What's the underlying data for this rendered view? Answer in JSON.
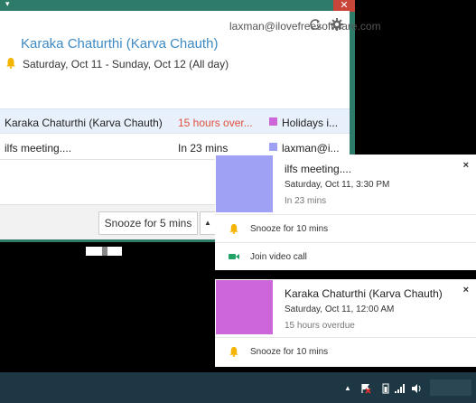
{
  "window": {
    "close_glyph": "✕",
    "caret_glyph": "▾",
    "accent": "#2d7b68"
  },
  "header": {
    "email": "laxman@ilovefreesoftware.com",
    "refresh_icon": "refresh-icon",
    "settings_icon": "gear-icon"
  },
  "event": {
    "title": "Karaka Chaturthi (Karva Chauth)",
    "date": "Saturday, Oct 11 - Sunday, Oct 12 (All day)",
    "title_color": "#3e8ac4"
  },
  "reminders": [
    {
      "title": "Karaka Chaturthi (Karva Chauth)",
      "time": "15 hours over...",
      "calendar": "Holidays i...",
      "color": "#cc66d9"
    },
    {
      "title": "ilfs meeting....",
      "time": "In 23 mins",
      "calendar": "laxman@i...",
      "color": "#9fa1f5"
    }
  ],
  "footer": {
    "snooze_label": "Snooze for 5 mins",
    "caret_glyph": "▲"
  },
  "notifications": [
    {
      "title": "ilfs meeting....",
      "date": "Saturday, Oct 11, 3:30 PM",
      "status": "In 23 mins",
      "color": "#9fa1f5",
      "close_glyph": "×",
      "actions": [
        {
          "label": "Snooze for 10 mins",
          "icon": "bell-icon"
        },
        {
          "label": "Join video call",
          "icon": "video-icon"
        }
      ]
    },
    {
      "title": "Karaka Chaturthi (Karva Chauth)",
      "date": "Saturday, Oct 11, 12:00 AM",
      "status": "15 hours overdue",
      "color": "#cc66d9",
      "close_glyph": "×",
      "actions": [
        {
          "label": "Snooze for 10 mins",
          "icon": "bell-icon"
        }
      ]
    }
  ],
  "taskbar": {
    "color": "#1d3844",
    "tray_icons": [
      "show-hidden-icon",
      "action-center-flag-icon",
      "battery-icon",
      "signal-icon",
      "volume-icon"
    ],
    "caret_glyph": "▲"
  }
}
